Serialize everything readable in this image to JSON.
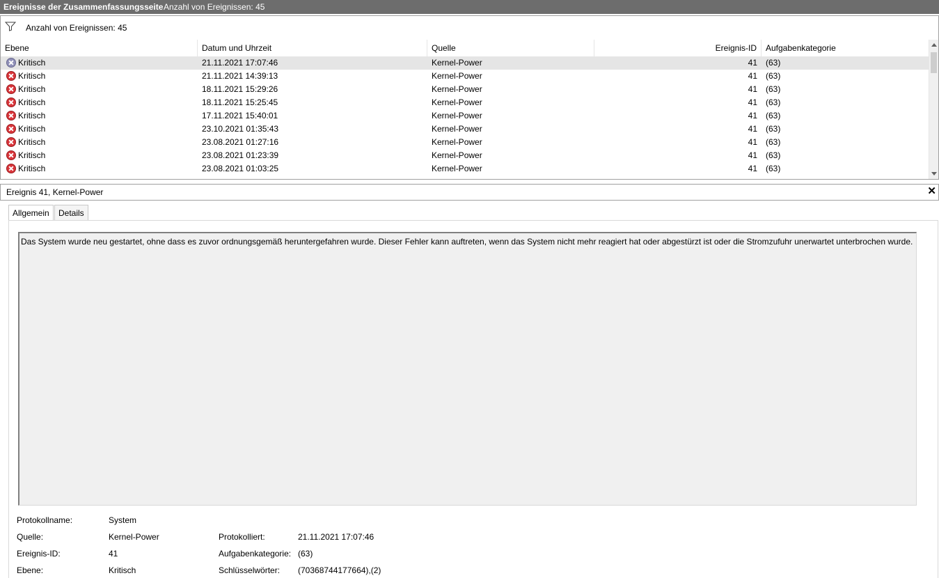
{
  "titlebar": {
    "title": "Ereignisse der Zusammenfassungsseite",
    "count": "Anzahl von Ereignissen: 45"
  },
  "filter": {
    "icon": "filter-icon",
    "text": "Anzahl von Ereignissen: 45"
  },
  "grid": {
    "columns": [
      "Ebene",
      "Datum und Uhrzeit",
      "Quelle",
      "Ereignis-ID",
      "Aufgabenkategorie"
    ],
    "rows": [
      {
        "level": "Kritisch",
        "datetime": "21.11.2021 17:07:46",
        "source": "Kernel-Power",
        "id": "41",
        "category": "(63)"
      },
      {
        "level": "Kritisch",
        "datetime": "21.11.2021 14:39:13",
        "source": "Kernel-Power",
        "id": "41",
        "category": "(63)"
      },
      {
        "level": "Kritisch",
        "datetime": "18.11.2021 15:29:26",
        "source": "Kernel-Power",
        "id": "41",
        "category": "(63)"
      },
      {
        "level": "Kritisch",
        "datetime": "18.11.2021 15:25:45",
        "source": "Kernel-Power",
        "id": "41",
        "category": "(63)"
      },
      {
        "level": "Kritisch",
        "datetime": "17.11.2021 15:40:01",
        "source": "Kernel-Power",
        "id": "41",
        "category": "(63)"
      },
      {
        "level": "Kritisch",
        "datetime": "23.10.2021 01:35:43",
        "source": "Kernel-Power",
        "id": "41",
        "category": "(63)"
      },
      {
        "level": "Kritisch",
        "datetime": "23.08.2021 01:27:16",
        "source": "Kernel-Power",
        "id": "41",
        "category": "(63)"
      },
      {
        "level": "Kritisch",
        "datetime": "23.08.2021 01:23:39",
        "source": "Kernel-Power",
        "id": "41",
        "category": "(63)"
      },
      {
        "level": "Kritisch",
        "datetime": "23.08.2021 01:03:25",
        "source": "Kernel-Power",
        "id": "41",
        "category": "(63)"
      }
    ]
  },
  "details": {
    "title": "Ereignis 41, Kernel-Power",
    "close": "✕",
    "tabs": [
      "Allgemein",
      "Details"
    ],
    "description": "Das System wurde neu gestartet, ohne dass es zuvor ordnungsgemäß heruntergefahren wurde. Dieser Fehler kann auftreten, wenn das System nicht mehr reagiert hat oder abgestürzt ist oder die Stromzufuhr unerwartet unterbrochen wurde.",
    "props": {
      "logname_label": "Protokollname:",
      "logname_value": "System",
      "source_label": "Quelle:",
      "source_value": "Kernel-Power",
      "eventid_label": "Ereignis-ID:",
      "eventid_value": "41",
      "level_label": "Ebene:",
      "level_value": "Kritisch",
      "logged_label": "Protokolliert:",
      "logged_value": "21.11.2021 17:07:46",
      "category_label": "Aufgabenkategorie:",
      "category_value": "(63)",
      "keywords_label": "Schlüsselwörter:",
      "keywords_value": "(70368744177664),(2)"
    }
  }
}
